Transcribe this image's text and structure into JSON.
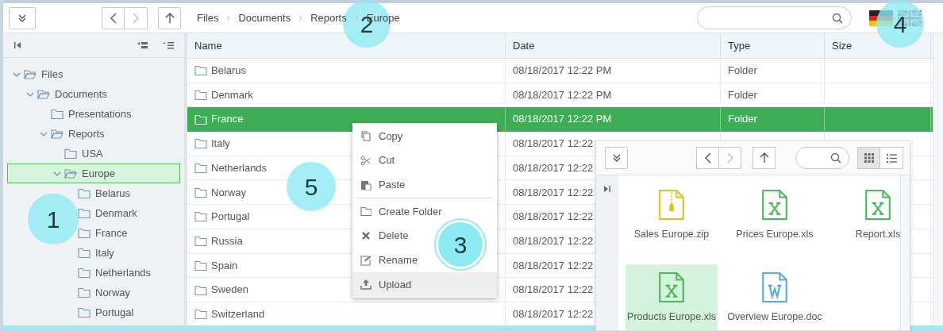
{
  "toolbar": {
    "breadcrumb": [
      "Files",
      "Documents",
      "Reports",
      "Europe"
    ]
  },
  "tree": [
    {
      "label": "Files",
      "expanded": true,
      "selected": false,
      "children": [
        {
          "label": "Documents",
          "expanded": true,
          "selected": false,
          "children": [
            {
              "label": "Presentations",
              "selected": false
            },
            {
              "label": "Reports",
              "expanded": true,
              "selected": false,
              "children": [
                {
                  "label": "USA",
                  "selected": false
                },
                {
                  "label": "Europe",
                  "expanded": true,
                  "selected": true,
                  "children": [
                    {
                      "label": "Belarus",
                      "selected": false
                    },
                    {
                      "label": "Denmark",
                      "selected": false
                    },
                    {
                      "label": "France",
                      "selected": false
                    },
                    {
                      "label": "Italy",
                      "selected": false
                    },
                    {
                      "label": "Netherlands",
                      "selected": false
                    },
                    {
                      "label": "Norway",
                      "selected": false
                    },
                    {
                      "label": "Portugal",
                      "selected": false
                    }
                  ]
                }
              ]
            }
          ]
        }
      ]
    }
  ],
  "table": {
    "columns": [
      "Name",
      "Date",
      "Type",
      "Size"
    ],
    "rows": [
      {
        "name": "Belarus",
        "date": "08/18/2017 12:22 PM",
        "type": "Folder",
        "selected": false
      },
      {
        "name": "Denmark",
        "date": "08/18/2017 12:22 PM",
        "type": "Folder",
        "selected": false
      },
      {
        "name": "France",
        "date": "08/18/2017 12:22 PM",
        "type": "Folder",
        "selected": true
      },
      {
        "name": "Italy",
        "date": "08/18/2017 12:22",
        "selected": false
      },
      {
        "name": "Netherlands",
        "date": "08/18/2017 12:22",
        "selected": false
      },
      {
        "name": "Norway",
        "date": "08/18/2017 12:22",
        "selected": false
      },
      {
        "name": "Portugal",
        "date": "08/18/2017 12:22",
        "selected": false
      },
      {
        "name": "Russia",
        "date": "08/18/2017 12:22",
        "selected": false
      },
      {
        "name": "Spain",
        "date": "08/18/2017 12:22",
        "selected": false
      },
      {
        "name": "Sweden",
        "date": "08/18/2017 12:22",
        "selected": false
      },
      {
        "name": "Switzerland",
        "date": "08/18/2017 12:22",
        "selected": false
      }
    ]
  },
  "context_menu": [
    {
      "label": "Copy",
      "kind": "copy",
      "highlighted": false,
      "separator_before": false
    },
    {
      "label": "Cut",
      "kind": "cut",
      "highlighted": false,
      "separator_before": false
    },
    {
      "label": "Paste",
      "kind": "paste",
      "highlighted": false,
      "separator_before": false
    },
    {
      "label": "Create Folder",
      "kind": "folder",
      "highlighted": false,
      "separator_before": true
    },
    {
      "label": "Delete",
      "kind": "delete",
      "highlighted": false,
      "separator_before": false
    },
    {
      "label": "Rename",
      "kind": "rename",
      "highlighted": false,
      "separator_before": false
    },
    {
      "label": "Upload",
      "kind": "upload",
      "highlighted": true,
      "separator_before": false
    }
  ],
  "second_window": {
    "view_grid_selected": true,
    "files": [
      {
        "name": "Sales Europe.zip",
        "kind": "zip",
        "selected": false
      },
      {
        "name": "Prices Europe.xls",
        "kind": "xls",
        "selected": false
      },
      {
        "name": "Report.xls",
        "kind": "xls",
        "selected": false
      },
      {
        "name": "Products Europe.xls",
        "kind": "xls",
        "selected": true
      },
      {
        "name": "Overview Europe.doc",
        "kind": "doc",
        "selected": false
      }
    ]
  },
  "callouts": [
    {
      "label": "1",
      "kind": "plain"
    },
    {
      "label": "2",
      "kind": "plain"
    },
    {
      "label": "3",
      "kind": "ring"
    },
    {
      "label": "4",
      "kind": "plain"
    },
    {
      "label": "5",
      "kind": "plain"
    }
  ]
}
